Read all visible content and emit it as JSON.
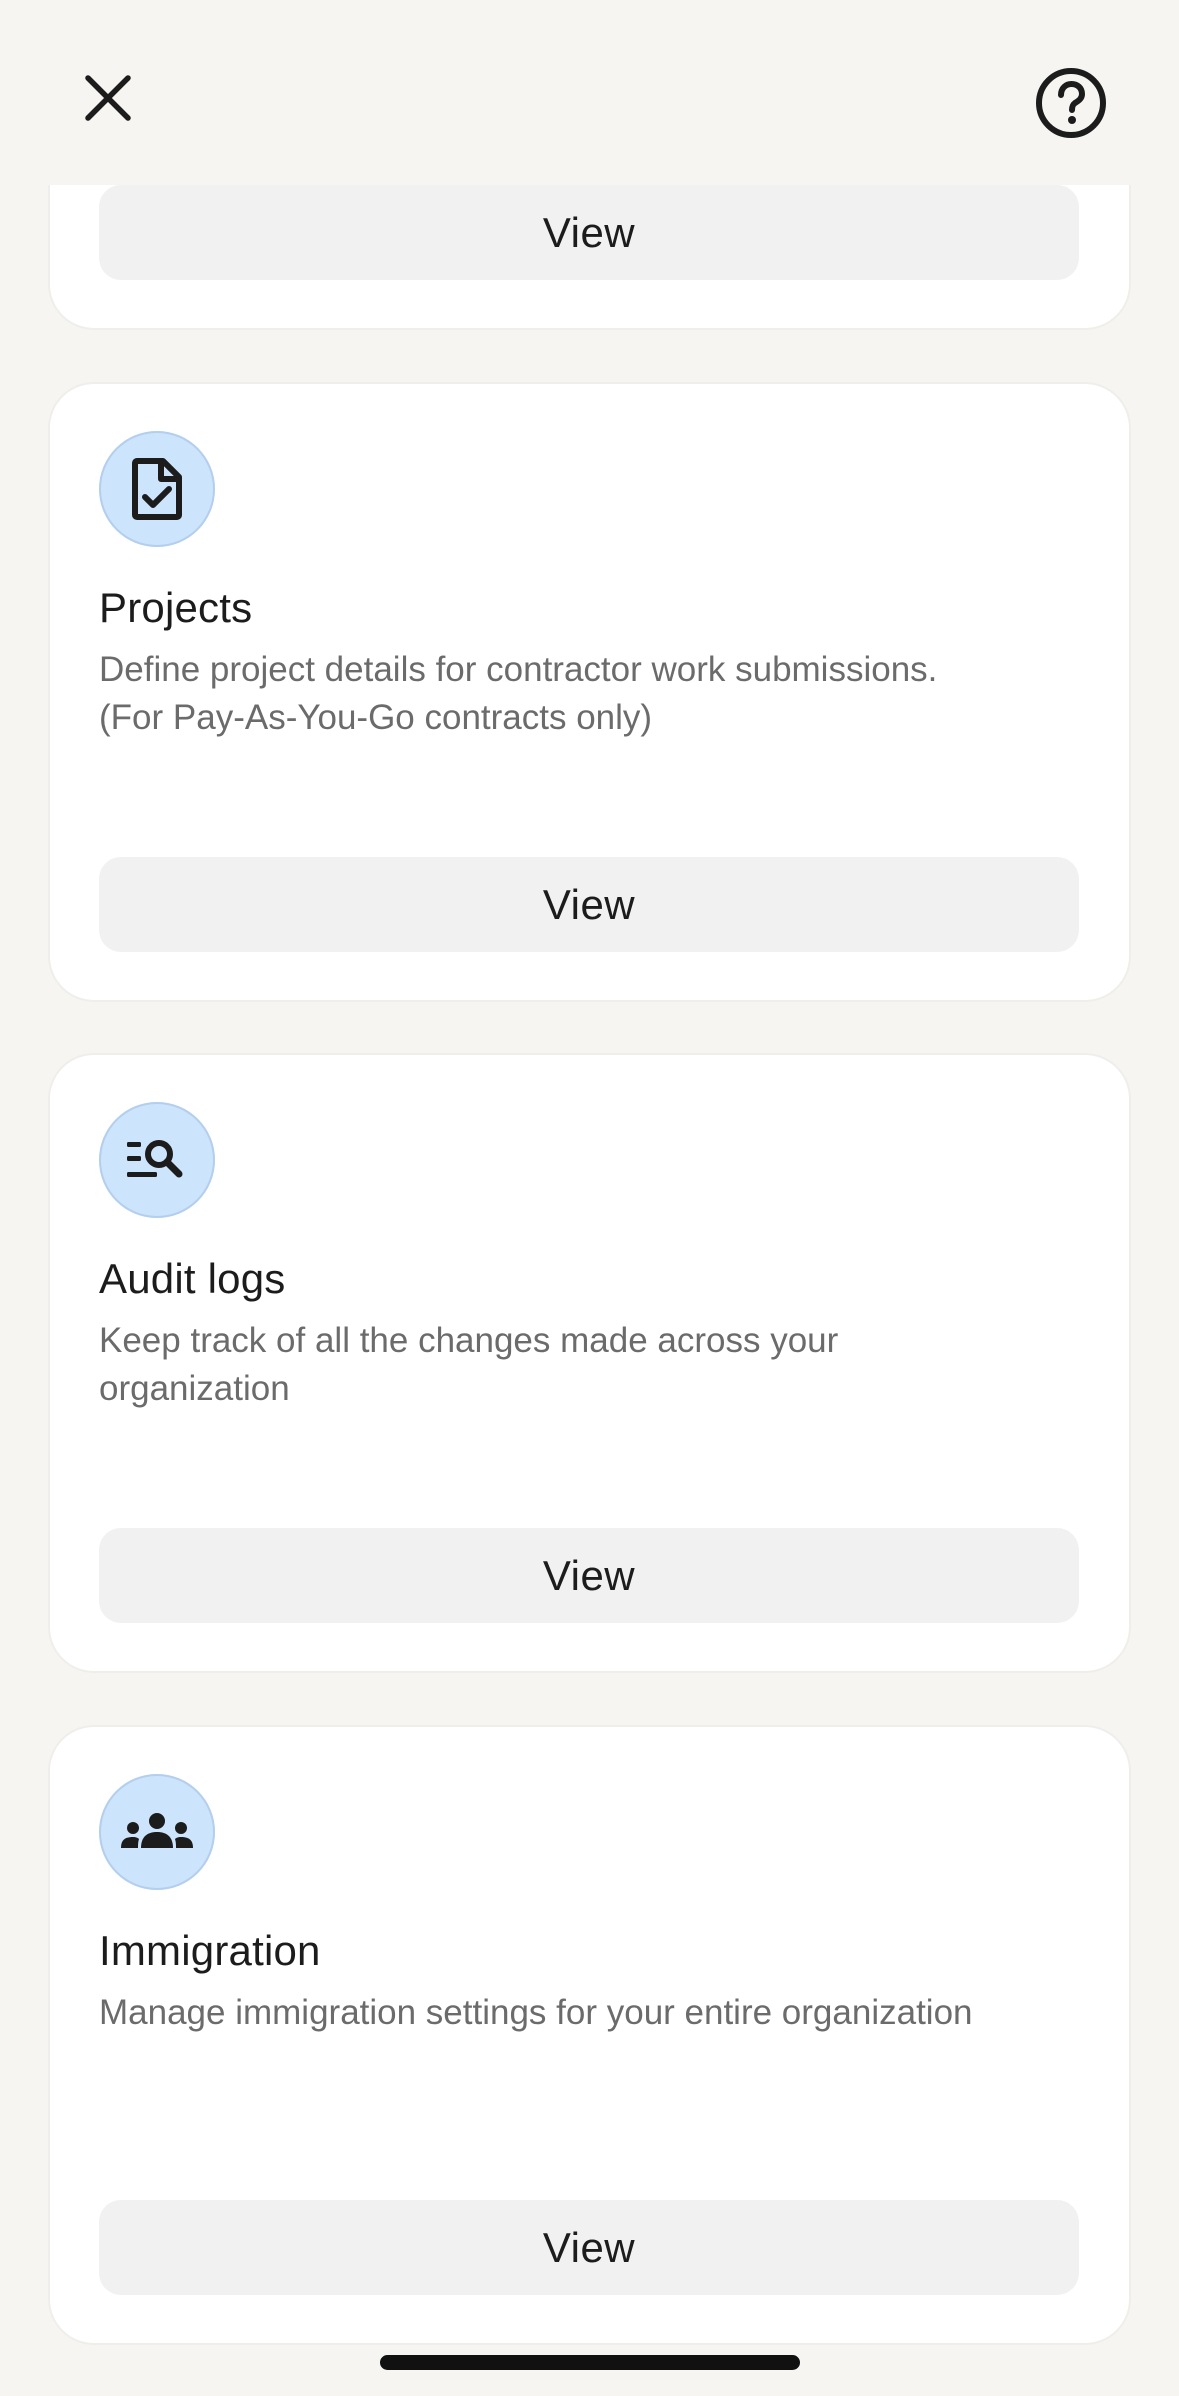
{
  "header": {
    "close_icon": "close-icon",
    "help_icon": "help-circle-icon"
  },
  "cards": [
    {
      "view_label": "View"
    },
    {
      "icon": "document-check-icon",
      "title": "Projects",
      "description": "Define project details for contractor work submissions.\n(For Pay-As-You-Go contracts only)",
      "view_label": "View"
    },
    {
      "icon": "list-search-icon",
      "title": "Audit logs",
      "description": "Keep track of all the changes made across your\norganization",
      "view_label": "View"
    },
    {
      "icon": "people-group-icon",
      "title": "Immigration",
      "description": "Manage immigration settings for your entire organization",
      "view_label": "View"
    }
  ],
  "colors": {
    "background": "#f6f5f2",
    "card": "#ffffff",
    "icon_bg": "#cce4fc",
    "button_bg": "#f1f1f1",
    "text_primary": "#1c1c1c",
    "text_secondary": "#6b6b6b"
  }
}
